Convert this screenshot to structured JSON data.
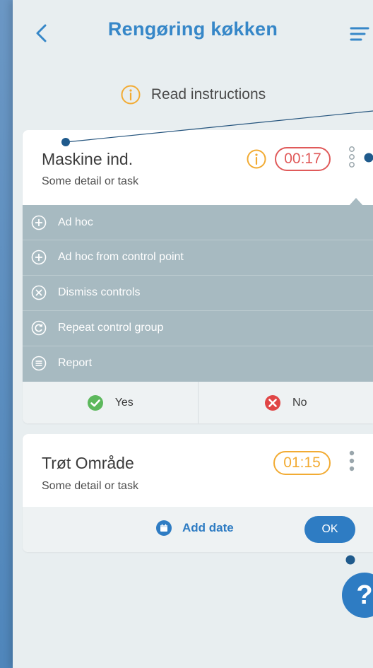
{
  "header": {
    "title": "Rengøring køkken",
    "back_icon": "chevron-left-icon",
    "menu_icon": "filter-menu-icon"
  },
  "instructions": {
    "label": "Read instructions",
    "icon": "info-icon"
  },
  "cards": [
    {
      "title": "Maskine ind.",
      "subtitle": "Some detail or task",
      "timer": "00:17",
      "timer_color": "#e05a5a",
      "actions": [
        {
          "label": "Ad hoc",
          "icon": "plus-circle-icon"
        },
        {
          "label": "Ad hoc from control point",
          "icon": "plus-circle-icon"
        },
        {
          "label": "Dismiss controls",
          "icon": "x-circle-icon"
        },
        {
          "label": "Repeat  control group",
          "icon": "repeat-circle-icon"
        },
        {
          "label": "Report",
          "icon": "report-circle-icon"
        }
      ],
      "yes_label": "Yes",
      "no_label": "No"
    },
    {
      "title": "Trøt Område",
      "subtitle": "Some detail or task",
      "timer": "01:15",
      "timer_color": "#f2ab33",
      "add_date_label": "Add date",
      "ok_label": "OK"
    }
  ],
  "help": {
    "label": "?"
  },
  "colors": {
    "accent": "#2e7cc3",
    "title": "#3687c8",
    "info": "#f2ab33",
    "yes": "#5cb85c",
    "no": "#e04646",
    "panel": "#a7bac1",
    "background": "#e8eef0"
  }
}
